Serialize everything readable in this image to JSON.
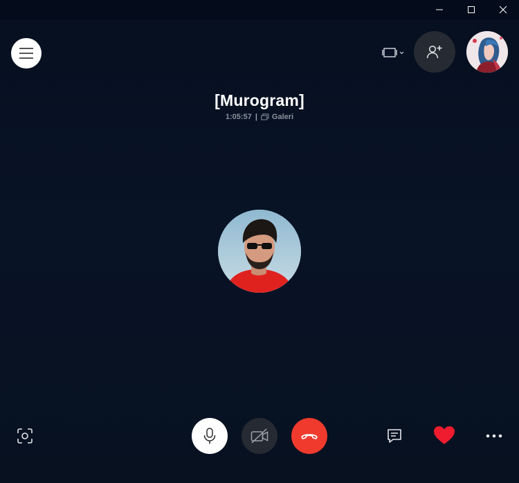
{
  "window": {
    "minimize_icon": "minimize-icon",
    "maximize_icon": "maximize-icon",
    "close_icon": "close-icon"
  },
  "call": {
    "title": "[Murogram]",
    "duration": "1:05:57",
    "separator": "|",
    "group_name": "Galeri"
  },
  "icons": {
    "menu": "hamburger-menu-icon",
    "layout": "layout-view-icon",
    "add_people": "add-person-icon",
    "screenshot": "screenshot-icon",
    "mic": "microphone-icon",
    "video_off": "video-off-icon",
    "hangup": "hang-up-icon",
    "chat": "chat-icon",
    "react": "heart-icon",
    "more": "more-options-icon"
  },
  "colors": {
    "background": "#081326",
    "hangup": "#f03a2e",
    "heart": "#ee1c2e",
    "dark_button": "#262a33"
  }
}
